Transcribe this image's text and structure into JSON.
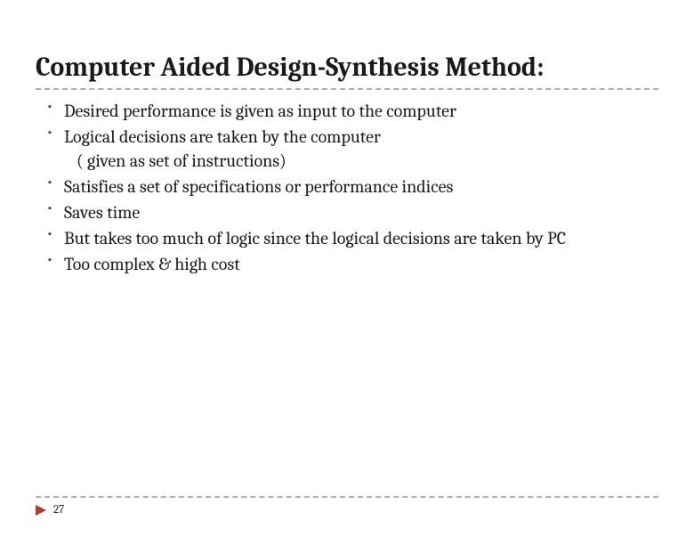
{
  "colors": {
    "accent": "#b73a2a",
    "divider": "#b0b0b0"
  },
  "title": "Computer Aided Design-Synthesis Method:",
  "bullets": [
    "Desired performance  is given as input to the computer",
    "Logical decisions are taken by the computer",
    " ( given as set of instructions)",
    "Satisfies  a set of specifications or performance indices",
    "Saves time",
    "But takes too much of logic since the logical decisions  are taken by PC",
    "Too complex   & high cost"
  ],
  "page_number": "27"
}
